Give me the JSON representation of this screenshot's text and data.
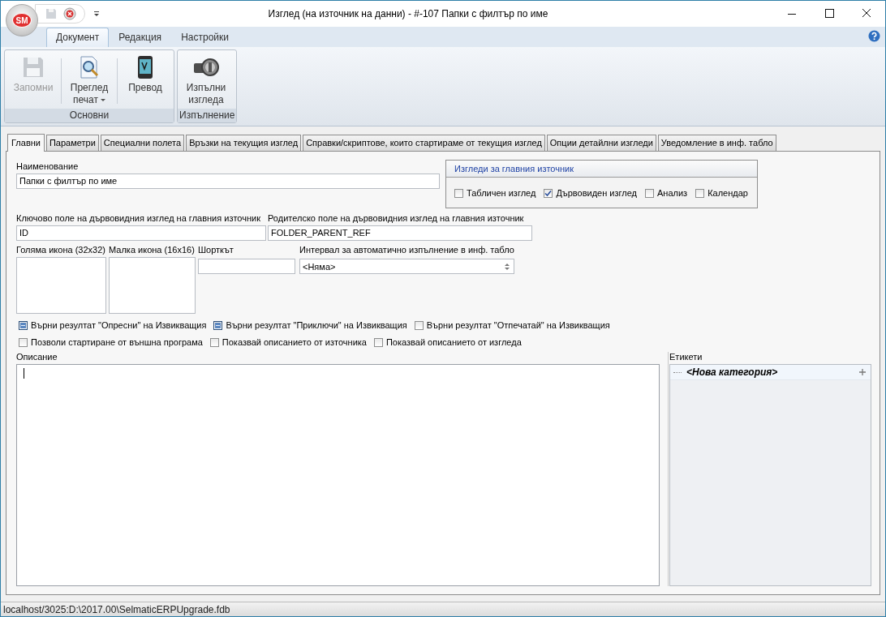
{
  "window": {
    "title": "Изглед (на източник на данни) - #-107 Папки с филтър по име",
    "app_badge": "SM"
  },
  "ribbon": {
    "tabs": [
      {
        "label": "Документ",
        "selected": true
      },
      {
        "label": "Редакция",
        "selected": false
      },
      {
        "label": "Настройки",
        "selected": false
      }
    ],
    "groups": [
      {
        "label": "Основни",
        "buttons": [
          {
            "label": "Запомни",
            "kind": "floppy",
            "disabled": true,
            "dropdown": false
          },
          {
            "label": "Преглед печат",
            "kind": "preview",
            "disabled": false,
            "dropdown": true
          },
          {
            "label": "Превод",
            "kind": "phone",
            "disabled": false,
            "dropdown": false
          }
        ]
      },
      {
        "label": "Изпълнение",
        "buttons": [
          {
            "label": "Изпълни изгледа",
            "kind": "key",
            "disabled": false,
            "dropdown": false
          }
        ]
      }
    ]
  },
  "tabs": [
    {
      "label": "Главни",
      "selected": true
    },
    {
      "label": "Параметри",
      "selected": false
    },
    {
      "label": "Специални полета",
      "selected": false
    },
    {
      "label": "Връзки на текущия изглед",
      "selected": false
    },
    {
      "label": "Справки/скриптове, които стартираме от текущия изглед",
      "selected": false
    },
    {
      "label": "Опции детайлни изгледи",
      "selected": false
    },
    {
      "label": "Уведомление в инф. табло",
      "selected": false
    }
  ],
  "name_field": {
    "label": "Наименование",
    "value": "Папки с филтър по име"
  },
  "views_group": {
    "title": "Изгледи за главния източник",
    "options": [
      {
        "label": "Табличен изглед",
        "checked": false
      },
      {
        "label": "Дървовиден изглед",
        "checked": true
      },
      {
        "label": "Анализ",
        "checked": false
      },
      {
        "label": "Календар",
        "checked": false
      }
    ]
  },
  "key_field": {
    "label": "Ключово поле на дървовидния изглед на главния източник",
    "value": "ID"
  },
  "parent_field": {
    "label": "Родителско поле на дървовидния изглед на главния източник",
    "value": "FOLDER_PARENT_REF"
  },
  "large_icon": {
    "label": "Голяма икона (32x32)"
  },
  "small_icon": {
    "label": "Малка икона (16x16)"
  },
  "shortcut": {
    "label": "Шорткът"
  },
  "interval": {
    "label": "Интервал за автоматично изпълнение в инф. табло",
    "value": "<Няма>"
  },
  "result_options": [
    {
      "label": "Върни резултат \"Опресни\" на Извикващия",
      "indeterminate": true
    },
    {
      "label": "Върни резултат \"Приключи\" на Извикващия",
      "indeterminate": true
    },
    {
      "label": "Върни резултат \"Отпечатай\" на Извикващия",
      "indeterminate": false
    }
  ],
  "other_options": [
    {
      "label": "Позволи стартиране от външна програма",
      "checked": false
    },
    {
      "label": "Показвай описанието от източника",
      "checked": false
    },
    {
      "label": "Показвай описанието от изгледа",
      "checked": false
    }
  ],
  "description": {
    "label": "Описание",
    "focused": true
  },
  "tags": {
    "label": "Етикети",
    "items": [
      {
        "label": "<Нова категория>"
      }
    ]
  },
  "status_bar": {
    "text": "localhost/3025:D:\\2017.00\\SelmaticERPUpgrade.fdb"
  }
}
